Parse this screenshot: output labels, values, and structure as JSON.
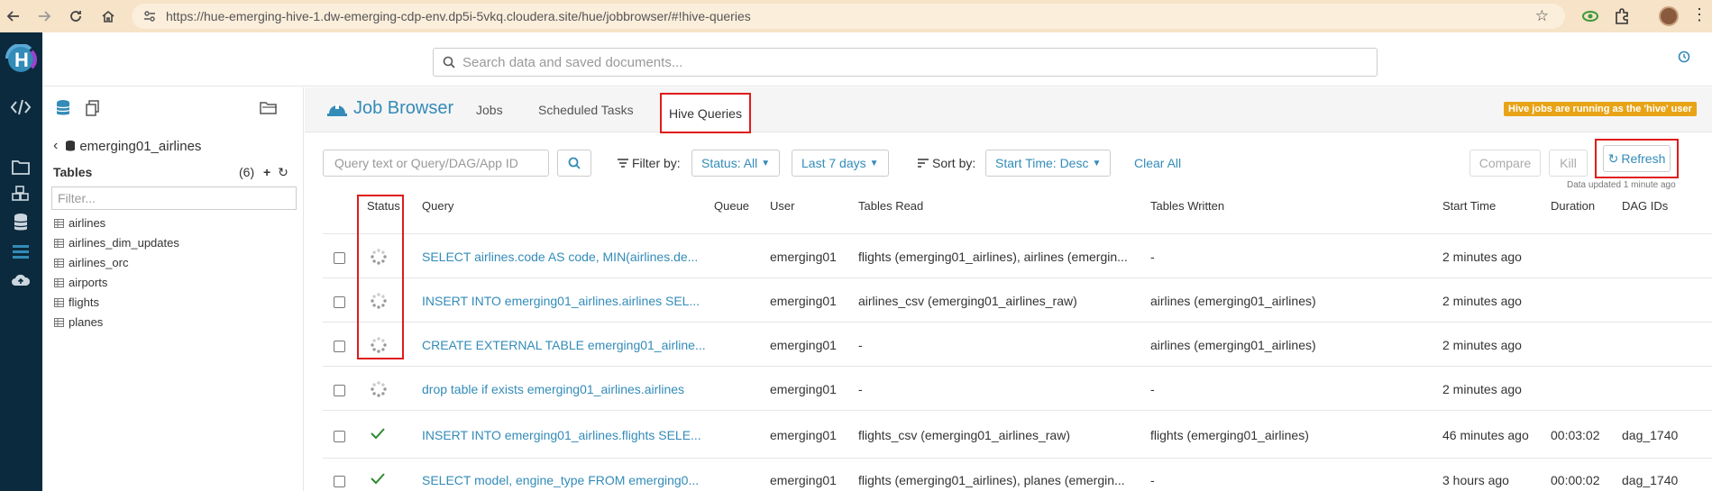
{
  "browser": {
    "url": "https://hue-emerging-hive-1.dw-emerging-cdp-env.dp5i-5vkq.cloudera.site/hue/jobbrowser/#!hive-queries"
  },
  "top": {
    "search_placeholder": "Search data and saved documents..."
  },
  "assist": {
    "database": "emerging01_airlines",
    "tables_label": "Tables",
    "tables_count": "(6)",
    "filter_placeholder": "Filter...",
    "tables": [
      "airlines",
      "airlines_dim_updates",
      "airlines_orc",
      "airports",
      "flights",
      "planes"
    ]
  },
  "header": {
    "title": "Job Browser",
    "tabs": [
      "Jobs",
      "Scheduled Tasks",
      "Hive Queries"
    ],
    "hive_note": "Hive jobs are running as the 'hive' user"
  },
  "toolbar": {
    "query_placeholder": "Query text or Query/DAG/App ID",
    "filter_label": "Filter by:",
    "status_filter": "Status: All",
    "time_filter": "Last 7 days",
    "sort_label": "Sort by:",
    "sort_value": "Start Time: Desc",
    "clear_all": "Clear All",
    "compare": "Compare",
    "kill": "Kill",
    "refresh": "Refresh",
    "data_updated": "Data updated 1 minute ago"
  },
  "table": {
    "columns": [
      "Status",
      "Query",
      "Queue",
      "User",
      "Tables Read",
      "Tables Written",
      "Start Time",
      "Duration",
      "DAG IDs"
    ],
    "rows": [
      {
        "status": "running",
        "query": "SELECT airlines.code AS code, MIN(airlines.de...",
        "queue": "",
        "user": "emerging01",
        "read": "flights (emerging01_airlines), airlines (emergin...",
        "written": "-",
        "start": "2 minutes ago",
        "duration": "",
        "dag": ""
      },
      {
        "status": "running",
        "query": "INSERT INTO emerging01_airlines.airlines SEL...",
        "queue": "",
        "user": "emerging01",
        "read": "airlines_csv (emerging01_airlines_raw)",
        "written": "airlines (emerging01_airlines)",
        "start": "2 minutes ago",
        "duration": "",
        "dag": ""
      },
      {
        "status": "running",
        "query": "CREATE EXTERNAL TABLE emerging01_airline...",
        "queue": "",
        "user": "emerging01",
        "read": "-",
        "written": "airlines (emerging01_airlines)",
        "start": "2 minutes ago",
        "duration": "",
        "dag": ""
      },
      {
        "status": "running",
        "query": "drop table if exists emerging01_airlines.airlines",
        "queue": "",
        "user": "emerging01",
        "read": "-",
        "written": "-",
        "start": "2 minutes ago",
        "duration": "",
        "dag": ""
      },
      {
        "status": "success",
        "query": "INSERT INTO emerging01_airlines.flights SELE...",
        "queue": "",
        "user": "emerging01",
        "read": "flights_csv (emerging01_airlines_raw)",
        "written": "flights (emerging01_airlines)",
        "start": "46 minutes ago",
        "duration": "00:03:02",
        "dag": "dag_1740"
      },
      {
        "status": "success",
        "query": "SELECT model, engine_type FROM emerging0...",
        "queue": "",
        "user": "emerging01",
        "read": "flights (emerging01_airlines), planes (emergin...",
        "written": "-",
        "start": "3 hours ago",
        "duration": "00:00:02",
        "dag": "dag_1740"
      }
    ]
  },
  "colors": {
    "accent": "#338bb8",
    "highlight": "#e01b1b",
    "sidebar": "#0b2a3d",
    "success": "#2e8b2e"
  }
}
